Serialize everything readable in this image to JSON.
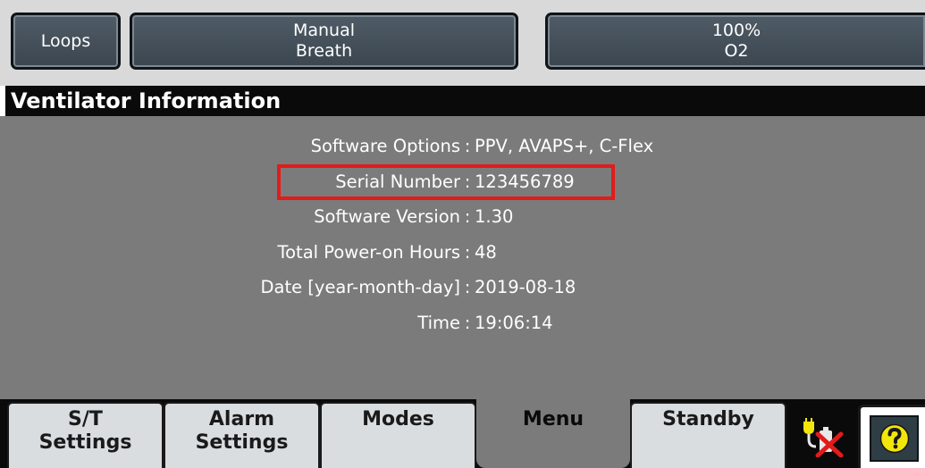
{
  "top_buttons": {
    "loops": [
      "Loops"
    ],
    "manual_breath": [
      "Manual",
      "Breath"
    ],
    "o2": [
      "100%",
      "O2"
    ]
  },
  "title": "Ventilator Information",
  "info": {
    "separator": ":",
    "rows": [
      {
        "label": "Software Options",
        "value": "PPV, AVAPS+, C-Flex"
      },
      {
        "label": "Serial Number",
        "value": "123456789"
      },
      {
        "label": "Software Version",
        "value": "1.30"
      },
      {
        "label": "Total Power-on Hours",
        "value": "48"
      },
      {
        "label": "Date [year-month-day]",
        "value": "2019-08-18"
      },
      {
        "label": "Time",
        "value": "19:06:14"
      }
    ]
  },
  "tabs": {
    "st_settings": [
      "S/T",
      "Settings"
    ],
    "alarm_settings": [
      "Alarm",
      "Settings"
    ],
    "modes": [
      "Modes"
    ],
    "menu": [
      "Menu"
    ],
    "standby": [
      "Standby"
    ]
  },
  "active_tab": "menu",
  "icons": {
    "power_status": "plug-battery-disconnected-icon",
    "help": "question-mark-help-icon"
  },
  "colors": {
    "button_bg": "#465059",
    "panel_bg": "#7b7b7b",
    "title_bg": "#0a0a0a",
    "highlight": "#e21b1b",
    "help_yellow": "#f2e60a"
  }
}
